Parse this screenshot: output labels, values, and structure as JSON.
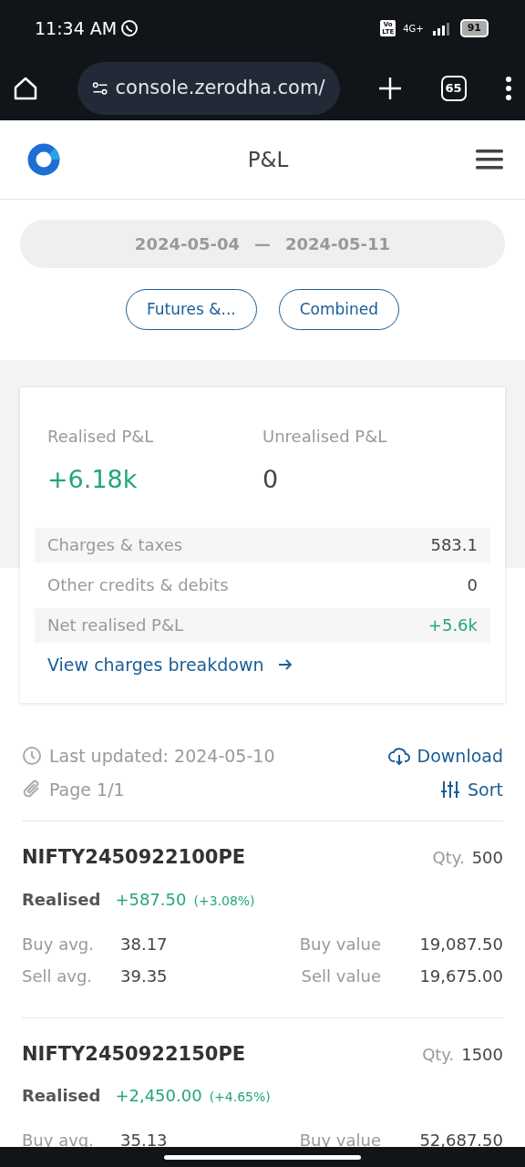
{
  "status_bar": {
    "time": "11:34 AM",
    "volte": [
      "Vo",
      "LTE"
    ],
    "network": "4G+",
    "battery": "91"
  },
  "browser": {
    "url": "console.zerodha.com/",
    "tab_count": "65"
  },
  "header": {
    "title": "P&L"
  },
  "date_range": {
    "from": "2024-05-04",
    "separator": "—",
    "to": "2024-05-11"
  },
  "filters": [
    "Futures &...",
    "Combined"
  ],
  "summary": {
    "realised_label": "Realised P&L",
    "realised_value": "+6.18k",
    "unrealised_label": "Unrealised P&L",
    "unrealised_value": "0",
    "rows": [
      {
        "label": "Charges & taxes",
        "value": "583.1",
        "positive": false
      },
      {
        "label": "Other credits & debits",
        "value": "0",
        "positive": false
      },
      {
        "label": "Net realised P&L",
        "value": "+5.6k",
        "positive": true
      }
    ],
    "link": "View charges breakdown"
  },
  "meta": {
    "last_updated": "Last updated: 2024-05-10",
    "page": "Page 1/1",
    "download": "Download",
    "sort": "Sort"
  },
  "positions": [
    {
      "symbol": "NIFTY2450922100PE",
      "qty_label": "Qty.",
      "qty": "500",
      "realised_label": "Realised",
      "realised": "+587.50",
      "percent": "(+3.08%)",
      "rows": [
        {
          "label": "Buy avg.",
          "value": "38.17",
          "label2": "Buy value",
          "value2": "19,087.50"
        },
        {
          "label": "Sell avg.",
          "value": "39.35",
          "label2": "Sell value",
          "value2": "19,675.00"
        }
      ]
    },
    {
      "symbol": "NIFTY2450922150PE",
      "qty_label": "Qty.",
      "qty": "1500",
      "realised_label": "Realised",
      "realised": "+2,450.00",
      "percent": "(+4.65%)",
      "rows": [
        {
          "label": "Buy avg.",
          "value": "35.13",
          "label2": "Buy value",
          "value2": "52,687.50"
        }
      ]
    }
  ]
}
